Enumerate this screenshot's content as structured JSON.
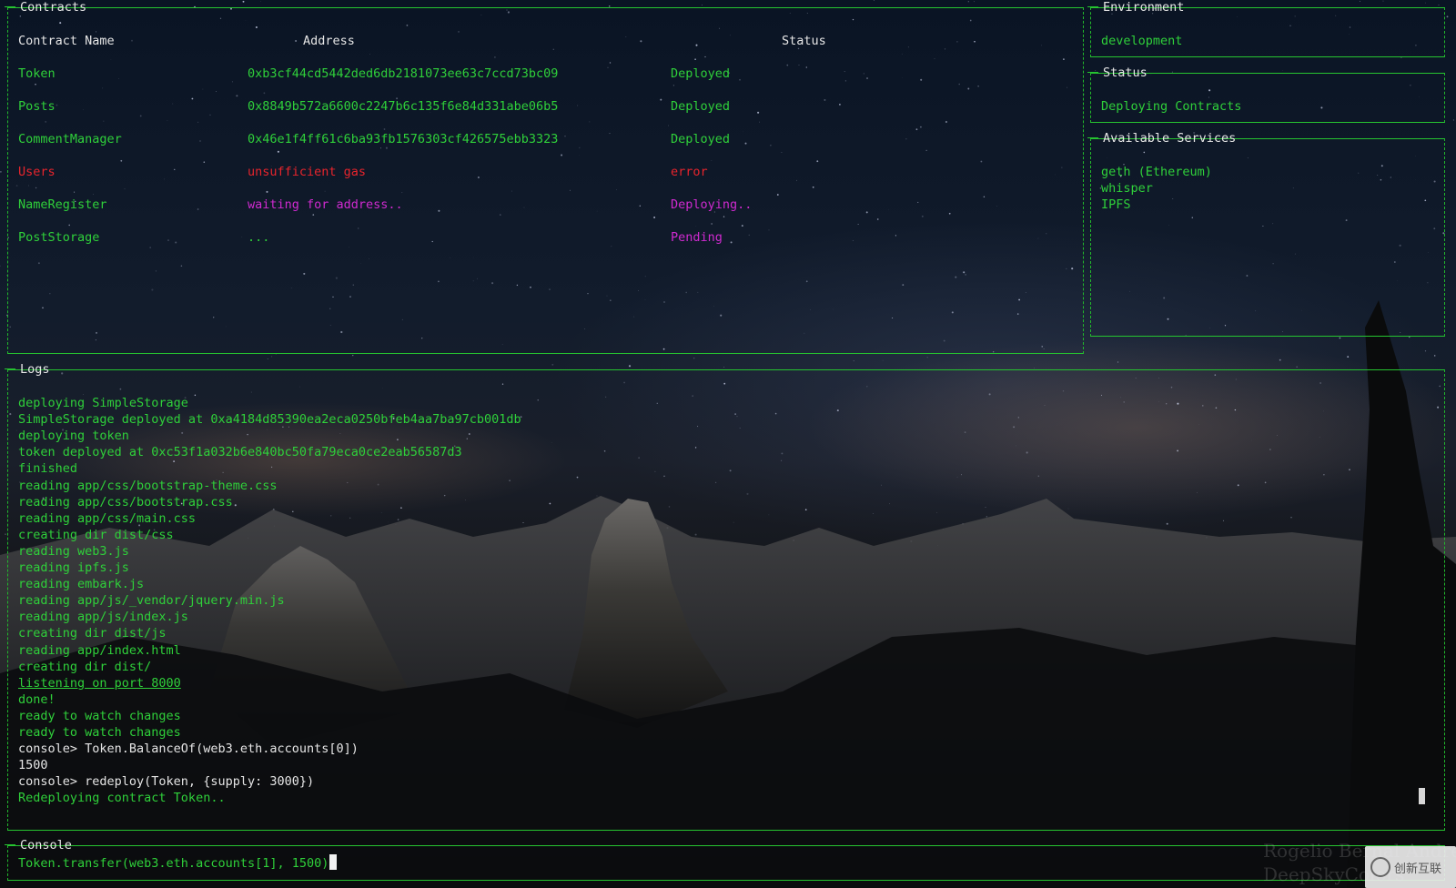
{
  "contracts": {
    "title": "Contracts",
    "columns": [
      "Contract Name",
      "Address",
      "Status"
    ],
    "rows": [
      {
        "name": "Token",
        "address": "0xb3cf44cd5442ded6db2181073ee63c7ccd73bc09",
        "status": "Deployed",
        "state": "ok"
      },
      {
        "name": "Posts",
        "address": "0x8849b572a6600c2247b6c135f6e84d331abe06b5",
        "status": "Deployed",
        "state": "ok"
      },
      {
        "name": "CommentManager",
        "address": "0x46e1f4ff61c6ba93fb1576303cf426575ebb3323",
        "status": "Deployed",
        "state": "ok"
      },
      {
        "name": "Users",
        "address": "unsufficient gas",
        "status": "error",
        "state": "error"
      },
      {
        "name": "NameRegister",
        "address": "waiting for address..",
        "status": "Deploying..",
        "state": "pending"
      },
      {
        "name": "PostStorage",
        "address": "...",
        "status": "Pending",
        "state": "pending-status"
      }
    ]
  },
  "environment": {
    "title": "Environment",
    "value": "development"
  },
  "status": {
    "title": "Status",
    "value": "Deploying Contracts"
  },
  "services": {
    "title": "Available Services",
    "items": [
      "geth (Ethereum)",
      "whisper",
      "IPFS"
    ]
  },
  "logs": {
    "title": "Logs",
    "lines": [
      {
        "text": "deploying SimpleStorage",
        "style": "green"
      },
      {
        "text": "SimpleStorage deployed at 0xa4184d85390ea2eca0250bfeb4aa7ba97cb001db",
        "style": "green"
      },
      {
        "text": "deploying token",
        "style": "green"
      },
      {
        "text": "token deployed at 0xc53f1a032b6e840bc50fa79eca0ce2eab56587d3",
        "style": "green"
      },
      {
        "text": "finished",
        "style": "green"
      },
      {
        "text": "reading app/css/bootstrap-theme.css",
        "style": "green"
      },
      {
        "text": "reading app/css/bootstrap.css",
        "style": "green"
      },
      {
        "text": "reading app/css/main.css",
        "style": "green"
      },
      {
        "text": "creating dir dist/css",
        "style": "green"
      },
      {
        "text": "reading web3.js",
        "style": "green"
      },
      {
        "text": "reading ipfs.js",
        "style": "green"
      },
      {
        "text": "reading embark.js",
        "style": "green"
      },
      {
        "text": "reading app/js/_vendor/jquery.min.js",
        "style": "green"
      },
      {
        "text": "reading app/js/index.js",
        "style": "green"
      },
      {
        "text": "creating dir dist/js",
        "style": "green"
      },
      {
        "text": "reading app/index.html",
        "style": "green"
      },
      {
        "text": "creating dir dist/",
        "style": "green"
      },
      {
        "text": "listening on port 8000",
        "style": "green underline"
      },
      {
        "text": "done!",
        "style": "green"
      },
      {
        "text": "ready to watch changes",
        "style": "green"
      },
      {
        "text": "ready to watch changes",
        "style": "green"
      },
      {
        "text": "console> Token.BalanceOf(web3.eth.accounts[0])",
        "style": "white"
      },
      {
        "text": "1500",
        "style": "white"
      },
      {
        "text": "console> redeploy(Token, {supply: 3000})",
        "style": "white"
      },
      {
        "text": "Redeploying contract Token..",
        "style": "green"
      }
    ]
  },
  "console": {
    "title": "Console",
    "input": "Token.transfer(web3.eth.accounts[1], 1500)"
  },
  "credit": {
    "line1": "Rogelio Bernal Andreo",
    "line2": "DeepSkyColors"
  },
  "watermark": {
    "label": "创新互联"
  },
  "colors": {
    "green": "#2fd03a",
    "red": "#e8242c",
    "magenta": "#d02ad0",
    "white": "#e6e6e6",
    "border": "#22b82c"
  }
}
